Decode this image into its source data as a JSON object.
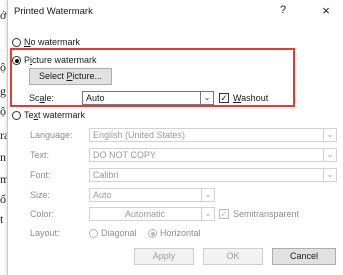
{
  "background_fragments": [
    "ớ",
    "ộ",
    "g",
    "ộ",
    "ra",
    "n",
    "m",
    "ố",
    "t"
  ],
  "dialog": {
    "title": "Printed Watermark",
    "help_label": "?",
    "close_label": "×"
  },
  "options": {
    "no_watermark": {
      "pre": "",
      "u": "N",
      "post": "o watermark"
    },
    "picture_watermark": {
      "pre": "P",
      "u": "i",
      "post": "cture watermark"
    },
    "text_watermark": {
      "pre": "Te",
      "u": "x",
      "post": "t watermark"
    }
  },
  "picture": {
    "select_button": {
      "pre": "Select ",
      "u": "P",
      "post": "icture..."
    },
    "scale_label": {
      "pre": "Sc",
      "u": "a",
      "post": "le:"
    },
    "scale_value": "Auto",
    "washout_label": {
      "pre": "",
      "u": "W",
      "post": "ashout"
    },
    "washout_checked": true
  },
  "text": {
    "language_label": "Language:",
    "language_value": "English (United States)",
    "text_label": "Text:",
    "text_value": "DO NOT COPY",
    "font_label": "Font:",
    "font_value": "Calibri",
    "size_label": "Size:",
    "size_value": "Auto",
    "color_label": "Color:",
    "color_value": "Automatic",
    "semitransparent_label": "Semitransparent",
    "semitransparent_checked": true,
    "layout_label": "Layout:",
    "layout_diagonal": "Diagonal",
    "layout_horizontal": "Horizontal"
  },
  "buttons": {
    "apply": "Apply",
    "ok": "OK",
    "cancel": "Cancel"
  },
  "colors": {
    "highlight": "#e53935",
    "disabled_text": "#9a9a9a"
  },
  "icons": {
    "dropdown": "chevron-down-icon",
    "check": "checkmark-icon"
  }
}
